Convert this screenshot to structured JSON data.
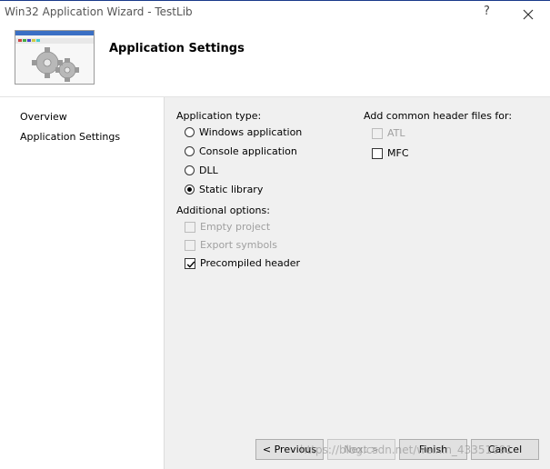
{
  "window": {
    "title": "Win32 Application Wizard - TestLib",
    "help_label": "?"
  },
  "header": {
    "title": "Application Settings"
  },
  "sidebar": {
    "items": [
      {
        "label": "Overview"
      },
      {
        "label": "Application Settings"
      }
    ]
  },
  "application_type": {
    "label": "Application type:",
    "options": [
      {
        "label": "Windows application",
        "checked": false
      },
      {
        "label": "Console application",
        "checked": false
      },
      {
        "label": "DLL",
        "checked": false
      },
      {
        "label": "Static library",
        "checked": true
      }
    ]
  },
  "additional_options": {
    "label": "Additional options:",
    "options": [
      {
        "label": "Empty project",
        "checked": false,
        "enabled": false
      },
      {
        "label": "Export symbols",
        "checked": false,
        "enabled": false
      },
      {
        "label": "Precompiled header",
        "checked": true,
        "enabled": true
      }
    ]
  },
  "common_headers": {
    "label": "Add common header files for:",
    "options": [
      {
        "label": "ATL",
        "checked": false,
        "enabled": false
      },
      {
        "label": "MFC",
        "checked": false,
        "enabled": true
      }
    ]
  },
  "buttons": {
    "previous": "< Previous",
    "next": "Next >",
    "finish": "Finish",
    "cancel": "Cancel"
  },
  "watermark": "https://blog.csdn.net/weixin_43351691"
}
